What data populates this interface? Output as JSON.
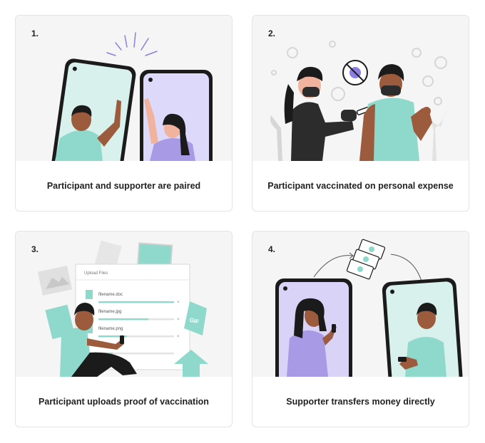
{
  "steps": [
    {
      "number": "1.",
      "caption": "Participant and supporter are paired"
    },
    {
      "number": "2.",
      "caption": "Participant vaccinated on personal expense"
    },
    {
      "number": "3.",
      "caption": "Participant uploads proof of vaccination"
    },
    {
      "number": "4.",
      "caption": "Supporter transfers money directly"
    }
  ],
  "upload_dialog": {
    "title": "Upload Files",
    "files": [
      "filename.doc",
      "filename.jpg",
      "filename.png"
    ]
  },
  "colors": {
    "teal": "#8fd9cc",
    "lavender": "#d9d4f7",
    "dark": "#1b1b1b",
    "skin": "#9c5b3d",
    "card_bg": "#f5f5f5"
  },
  "icons": [
    "vaccine-icon",
    "virus-icon",
    "money-icon",
    "file-icon",
    "upload-arrow-icon",
    "image-icon"
  ]
}
